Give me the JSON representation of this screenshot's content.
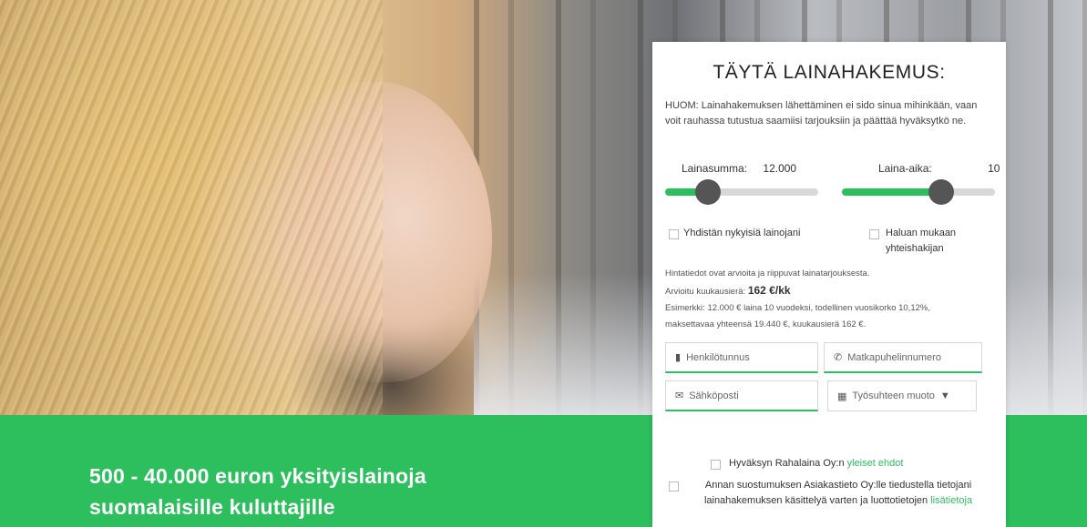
{
  "hero": {
    "tagline_line1": "500 - 40.000 euron yksityislainoja",
    "tagline_line2": "suomalaisille kuluttajille"
  },
  "form": {
    "title": "TÄYTÄ LAINAHAKEMUS:",
    "note": "HUOM: Lainahakemuksen lähettäminen ei sido sinua mihinkään, vaan voit rauhassa tutustua saamiisi tarjouksiin ja päättää hyväksytkö ne.",
    "amount_slider": {
      "label": "Lainasumma:",
      "value": "12.000",
      "level": 0.28
    },
    "term_slider": {
      "label": "Laina-aika:",
      "value": "10",
      "level": 0.65
    },
    "option_1": "Yhdistän nykyisiä lainojani",
    "option_2": "Haluan mukaan yhteishakijan",
    "info_line1": "Hintatiedot ovat arvioita ja riippuvat lainatarjouksesta.",
    "info_line2_prefix": "Arvioitu kuukausierä:",
    "info_monthly": "162 €/kk",
    "info_line3": "Esimerkki: 12.000 € laina 10 vuodeksi, todellinen vuosikorko 10,12%,",
    "info_line4": "maksettavaa yhteensä 19.440 €, kuukausierä 162 €.",
    "fields": {
      "ssn_placeholder": "Henkilötunnus",
      "phone_placeholder": "Matkapuhelinnumero",
      "email_placeholder": "Sähköposti",
      "employment_placeholder": "Työsuhteen muoto"
    },
    "consent_1_text": "Hyväksyn Rahalaina Oy:n",
    "consent_1_link": "yleiset ehdot",
    "consent_2_text": "Annan suostumuksen Asiakastieto Oy:lle tiedustella tietojani lainahakemuksen käsittelyä varten ja luottotietojen ",
    "consent_2_link": "lisätietoja"
  },
  "colors": {
    "accent": "#2dbe5e",
    "knob": "#555555",
    "track": "#d8d8d8"
  },
  "icons": {
    "ssn": "id-card-icon",
    "phone": "phone-icon",
    "email": "envelope-icon",
    "employment": "briefcase-icon",
    "dropdown": "caret-down-icon"
  }
}
